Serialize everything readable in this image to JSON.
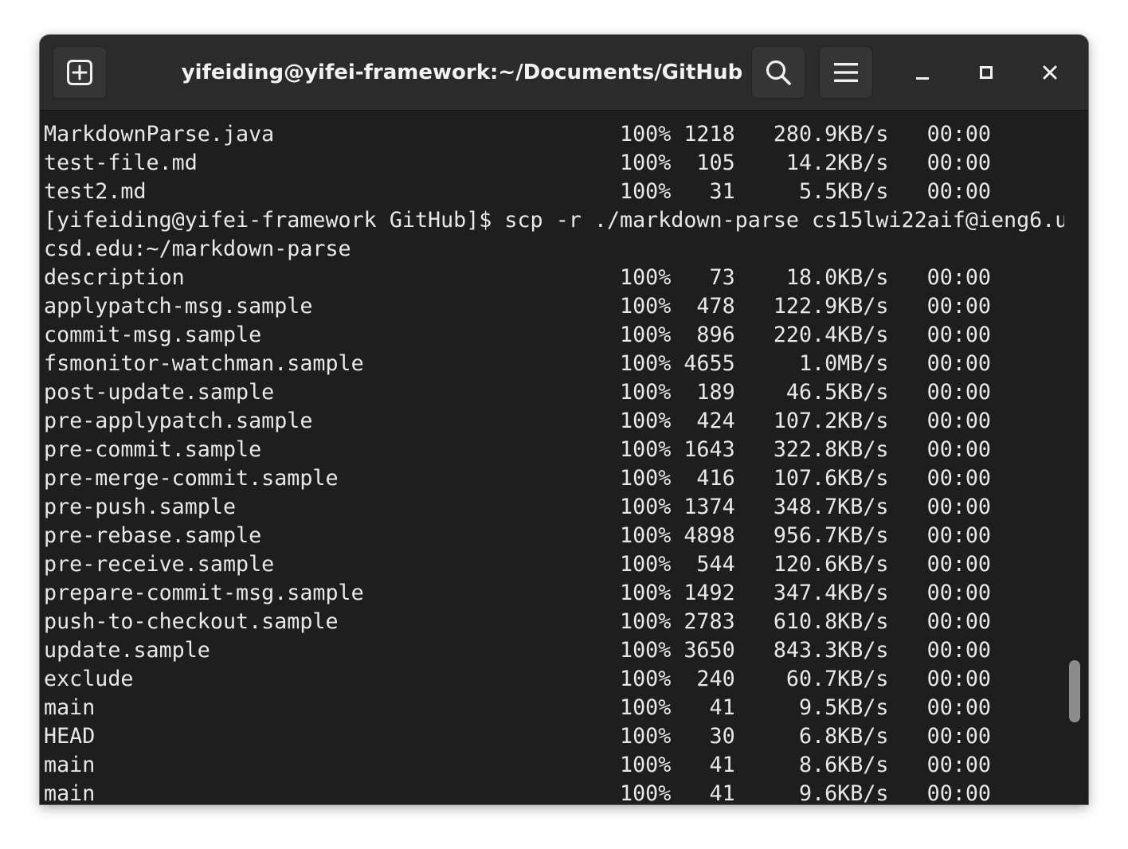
{
  "window": {
    "title": "yifeiding@yifei-framework:~/Documents/GitHub"
  },
  "icons": {
    "new_tab": "new-tab-icon",
    "search": "search-icon",
    "menu": "hamburger-menu-icon",
    "minimize": "minimize-icon",
    "maximize": "maximize-icon",
    "close": "close-icon"
  },
  "colors": {
    "terminal_bg": "#1e1e1e",
    "titlebar_bg": "#2b2b2b",
    "text": "#e8e8e8"
  },
  "scrollbar": {
    "position_fraction": 0.87,
    "visible_fraction": 0.09
  },
  "terminal": {
    "lines": [
      "MarkdownParse.java                           100% 1218   280.9KB/s   00:00",
      "test-file.md                                 100%  105    14.2KB/s   00:00",
      "test2.md                                     100%   31     5.5KB/s   00:00",
      "[yifeiding@yifei-framework GitHub]$ scp -r ./markdown-parse cs15lwi22aif@ieng6.u",
      "csd.edu:~/markdown-parse",
      "description                                  100%   73    18.0KB/s   00:00",
      "applypatch-msg.sample                        100%  478   122.9KB/s   00:00",
      "commit-msg.sample                            100%  896   220.4KB/s   00:00",
      "fsmonitor-watchman.sample                    100% 4655     1.0MB/s   00:00",
      "post-update.sample                           100%  189    46.5KB/s   00:00",
      "pre-applypatch.sample                        100%  424   107.2KB/s   00:00",
      "pre-commit.sample                            100% 1643   322.8KB/s   00:00",
      "pre-merge-commit.sample                      100%  416   107.6KB/s   00:00",
      "pre-push.sample                              100% 1374   348.7KB/s   00:00",
      "pre-rebase.sample                            100% 4898   956.7KB/s   00:00",
      "pre-receive.sample                           100%  544   120.6KB/s   00:00",
      "prepare-commit-msg.sample                    100% 1492   347.4KB/s   00:00",
      "push-to-checkout.sample                      100% 2783   610.8KB/s   00:00",
      "update.sample                                100% 3650   843.3KB/s   00:00",
      "exclude                                      100%  240    60.7KB/s   00:00",
      "main                                         100%   41     9.5KB/s   00:00",
      "HEAD                                         100%   30     6.8KB/s   00:00",
      "main                                         100%   41     8.6KB/s   00:00",
      "main                                         100%   41     9.6KB/s   00:00"
    ]
  }
}
